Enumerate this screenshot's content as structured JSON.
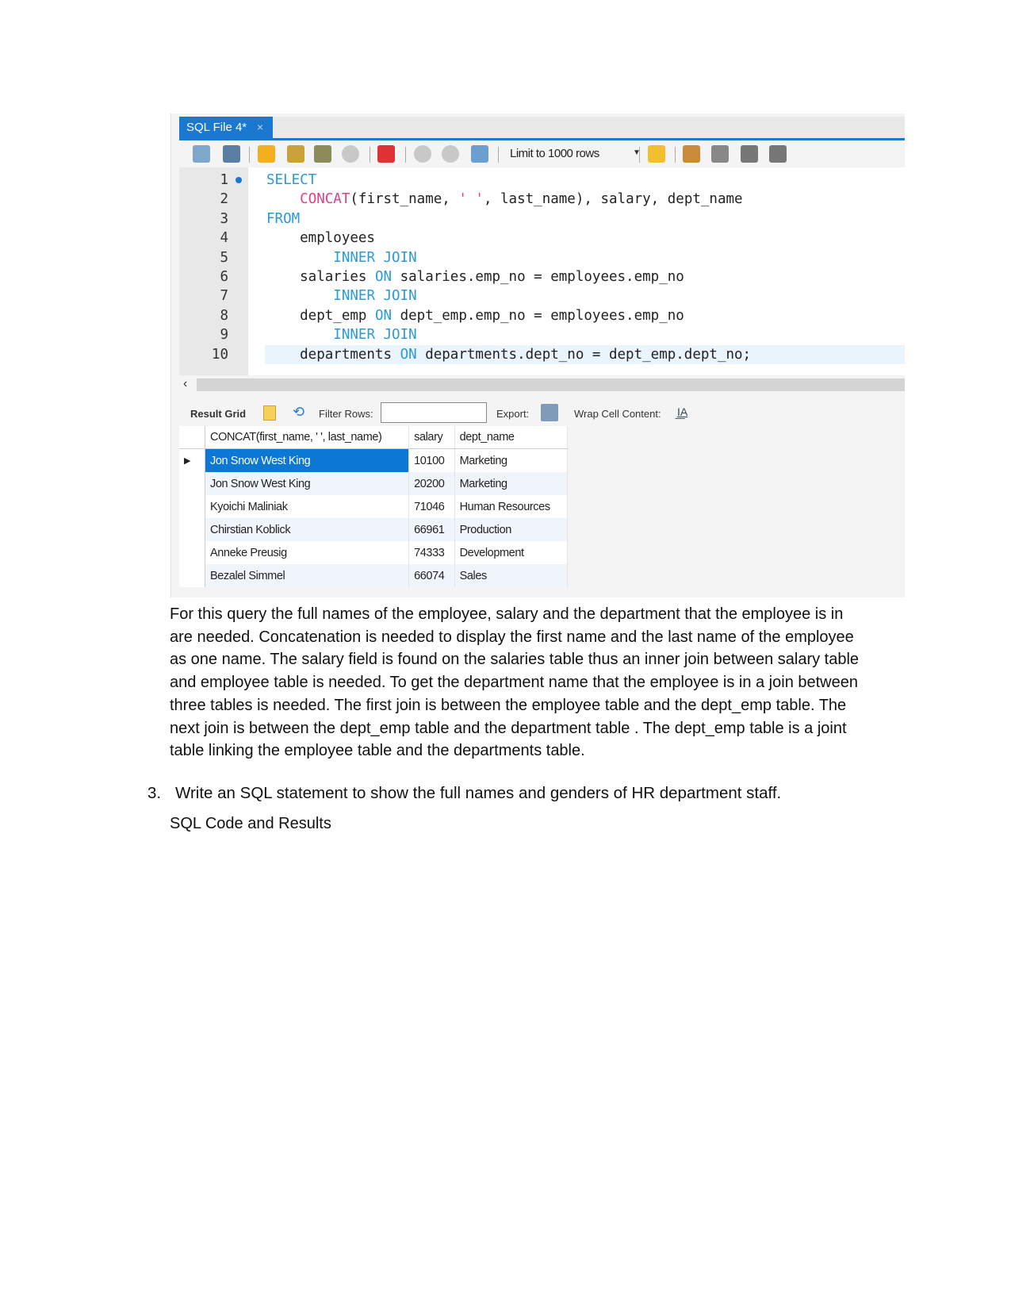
{
  "screenshot": {
    "tab": {
      "label": "SQL File 4*",
      "close": "×"
    },
    "toolbar": {
      "icons": [
        "open-folder-icon",
        "save-icon",
        "execute-icon",
        "execute-current-icon",
        "explain-icon",
        "stop-icon",
        "toggle-error-icon",
        "commit-icon",
        "rollback-icon",
        "autocommit-icon",
        "bookmark-star-icon",
        "beautify-icon",
        "find-icon",
        "invisible-chars-icon",
        "wrap-icon"
      ],
      "limit_label": "Limit to 1000 rows"
    },
    "editor": {
      "current_line": 10,
      "lines": [
        {
          "n": "1",
          "marker": true,
          "tokens": [
            [
              "SELECT",
              "kw"
            ]
          ]
        },
        {
          "n": "2",
          "tokens": [
            [
              "    ",
              ""
            ],
            [
              "CONCAT",
              "fn"
            ],
            [
              "(first_name, ",
              ""
            ],
            [
              "' '",
              "str"
            ],
            [
              ", last_name), salary, dept_name",
              ""
            ]
          ]
        },
        {
          "n": "3",
          "tokens": [
            [
              "FROM",
              "kw"
            ]
          ]
        },
        {
          "n": "4",
          "tokens": [
            [
              "    employees",
              ""
            ]
          ]
        },
        {
          "n": "5",
          "tokens": [
            [
              "        ",
              ""
            ],
            [
              "INNER JOIN",
              "kw"
            ]
          ]
        },
        {
          "n": "6",
          "tokens": [
            [
              "    salaries ",
              ""
            ],
            [
              "ON",
              "kw"
            ],
            [
              " salaries.emp_no = employees.emp_no",
              ""
            ]
          ]
        },
        {
          "n": "7",
          "tokens": [
            [
              "        ",
              ""
            ],
            [
              "INNER JOIN",
              "kw"
            ]
          ]
        },
        {
          "n": "8",
          "tokens": [
            [
              "    dept_emp ",
              ""
            ],
            [
              "ON",
              "kw"
            ],
            [
              " dept_emp.emp_no = employees.emp_no",
              ""
            ]
          ]
        },
        {
          "n": "9",
          "tokens": [
            [
              "        ",
              ""
            ],
            [
              "INNER JOIN",
              "kw"
            ]
          ]
        },
        {
          "n": "10",
          "tokens": [
            [
              "    departments ",
              ""
            ],
            [
              "ON",
              "kw"
            ],
            [
              " departments.dept_no = dept_emp.dept_no;",
              ""
            ]
          ]
        }
      ]
    },
    "results_toolbar": {
      "result_grid": "Result Grid",
      "filter_rows": "Filter Rows:",
      "filter_value": "",
      "export": "Export:",
      "wrap": "Wrap Cell Content:"
    },
    "grid": {
      "columns": [
        "CONCAT(first_name, ' ', last_name)",
        "salary",
        "dept_name"
      ],
      "rows": [
        [
          "Jon Snow West  King",
          "10100",
          "Marketing"
        ],
        [
          "Jon Snow West  King",
          "20200",
          "Marketing"
        ],
        [
          "Kyoichi Maliniak",
          "71046",
          "Human Resources"
        ],
        [
          "Chirstian Koblick",
          "66961",
          "Production"
        ],
        [
          "Anneke Preusig",
          "74333",
          "Development"
        ],
        [
          "Bezalel Simmel",
          "66074",
          "Sales"
        ]
      ],
      "selected_row": 0
    }
  },
  "paragraph": "For this query the full names of the employee, salary and the department that the employee is in are needed. Concatenation is needed to display the first name and the last name of the employee as one name. The salary field is found on the salaries table thus an inner join between salary table and employee table is needed. To get the department name that the employee is in a join between three tables is needed. The first join is between the employee table and the dept_emp table. The next join is between the dept_emp table and the department table . The dept_emp table is a joint table linking the employee table and the departments table.",
  "question": {
    "number": "3.",
    "text": "Write an SQL statement to show the full names and genders of HR department staff."
  },
  "subheading": "SQL Code and Results",
  "colors": {
    "accent": "#1b78d0",
    "keyword": "#2a9ad6",
    "function": "#e0408a",
    "selection": "#0c78d4"
  }
}
